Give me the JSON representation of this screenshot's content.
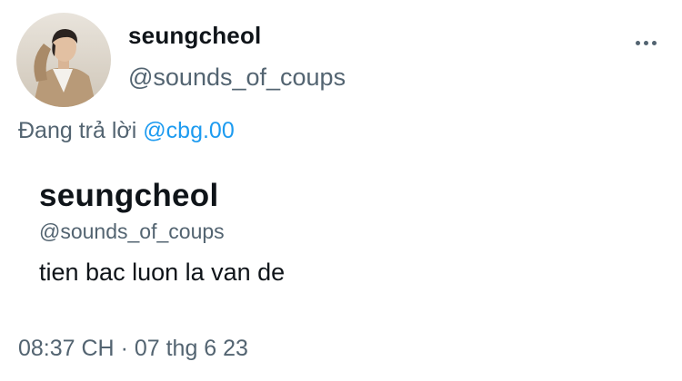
{
  "author": {
    "display_name": "seungcheol",
    "handle": "@sounds_of_coups",
    "avatar_icon": "profile-photo"
  },
  "more_icon": "more-options-icon",
  "reply": {
    "prefix": "Đang trả lời ",
    "mention": "@cbg.00"
  },
  "content": {
    "name": "seungcheol",
    "handle": "@sounds_of_coups",
    "text": "tien bac luon la van de"
  },
  "meta": {
    "time": "08:37 CH",
    "separator": " · ",
    "date": "07 thg 6 23"
  },
  "colors": {
    "text_primary": "#0f1419",
    "text_secondary": "#536471",
    "link": "#1d9bf0"
  }
}
